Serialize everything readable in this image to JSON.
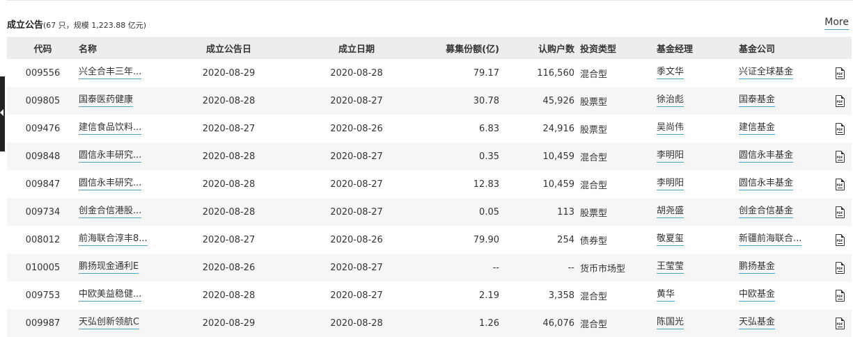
{
  "header": {
    "title": "成立公告",
    "subtitle": "(67 只，规模 1,223.88 亿元)",
    "more_label": "More"
  },
  "table": {
    "columns": [
      "代码",
      "名称",
      "成立公告日",
      "成立日期",
      "募集份额(亿)",
      "认购户数",
      "投资类型",
      "基金经理",
      "基金公司"
    ],
    "rows": [
      {
        "code": "009556",
        "name": "兴全合丰三年...",
        "announce_date": "2020-08-29",
        "setup_date": "2020-08-28",
        "shares": "79.17",
        "subscribers": "116,560",
        "type": "混合型",
        "manager": "季文华",
        "company": "兴证全球基金",
        "pdf": "PDF"
      },
      {
        "code": "009805",
        "name": "国泰医药健康",
        "announce_date": "2020-08-28",
        "setup_date": "2020-08-27",
        "shares": "30.78",
        "subscribers": "45,926",
        "type": "股票型",
        "manager": "徐治彪",
        "company": "国泰基金",
        "pdf": "PDF"
      },
      {
        "code": "009476",
        "name": "建信食品饮料...",
        "announce_date": "2020-08-27",
        "setup_date": "2020-08-26",
        "shares": "6.83",
        "subscribers": "24,916",
        "type": "股票型",
        "manager": "吴尚伟",
        "company": "建信基金",
        "pdf": "PDF"
      },
      {
        "code": "009848",
        "name": "圆信永丰研究...",
        "announce_date": "2020-08-28",
        "setup_date": "2020-08-27",
        "shares": "0.35",
        "subscribers": "10,459",
        "type": "混合型",
        "manager": "李明阳",
        "company": "圆信永丰基金",
        "pdf": "PDF"
      },
      {
        "code": "009847",
        "name": "圆信永丰研究...",
        "announce_date": "2020-08-28",
        "setup_date": "2020-08-27",
        "shares": "12.83",
        "subscribers": "10,459",
        "type": "混合型",
        "manager": "李明阳",
        "company": "圆信永丰基金",
        "pdf": "PDF"
      },
      {
        "code": "009734",
        "name": "创金合信港股...",
        "announce_date": "2020-08-28",
        "setup_date": "2020-08-27",
        "shares": "0.05",
        "subscribers": "113",
        "type": "股票型",
        "manager": "胡尧盛",
        "company": "创金合信基金",
        "pdf": "PDF"
      },
      {
        "code": "008012",
        "name": "前海联合淳丰8...",
        "announce_date": "2020-08-27",
        "setup_date": "2020-08-26",
        "shares": "79.90",
        "subscribers": "254",
        "type": "债券型",
        "manager": "敬夏玺",
        "company": "新疆前海联合...",
        "pdf": "PDF"
      },
      {
        "code": "010005",
        "name": "鹏扬现金通利E",
        "announce_date": "2020-08-26",
        "setup_date": "2020-08-27",
        "shares": "--",
        "subscribers": "--",
        "type": "货币市场型",
        "manager": "王莹莹",
        "company": "鹏扬基金",
        "pdf": "PDF"
      },
      {
        "code": "009753",
        "name": "中欧美益稳健...",
        "announce_date": "2020-08-28",
        "setup_date": "2020-08-27",
        "shares": "2.19",
        "subscribers": "3,358",
        "type": "混合型",
        "manager": "黄华",
        "company": "中欧基金",
        "pdf": "PDF"
      },
      {
        "code": "009987",
        "name": "天弘创新领航C",
        "announce_date": "2020-08-29",
        "setup_date": "2020-08-28",
        "shares": "1.26",
        "subscribers": "46,076",
        "type": "混合型",
        "manager": "陈国光",
        "company": "天弘基金",
        "pdf": "PDF"
      }
    ]
  },
  "colors": {
    "link_underline": "#4aa0c8",
    "header_bg": "#ededed",
    "row_alt_bg": "#f6f6f6",
    "text": "#333333"
  },
  "icons": {
    "pdf": "pdf-icon",
    "collapse": "chevron-left-icon"
  }
}
